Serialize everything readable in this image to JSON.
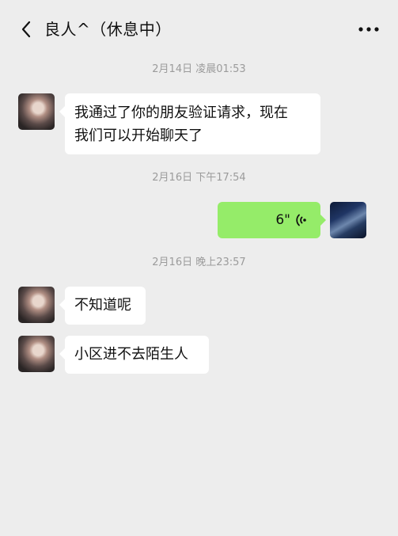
{
  "header": {
    "title": "良人^（休息中）",
    "back_icon": "chevron-left-icon",
    "more_icon": "more-dots-icon"
  },
  "timestamps": [
    "2月14日 凌晨01:53",
    "2月16日 下午17:54",
    "2月16日 晚上23:57"
  ],
  "messages": [
    {
      "side": "left",
      "lines": [
        "我通过了你的朋友验证请求，现在",
        "我们可以开始聊天了"
      ]
    },
    {
      "side": "right",
      "type": "voice",
      "duration": "6\""
    },
    {
      "side": "left",
      "text": "不知道呢"
    },
    {
      "side": "left",
      "text": "小区进不去陌生人"
    }
  ],
  "colors": {
    "background": "#ededed",
    "left_bubble": "#ffffff",
    "right_bubble": "#95ec69",
    "timestamp": "#9b9b9b"
  }
}
